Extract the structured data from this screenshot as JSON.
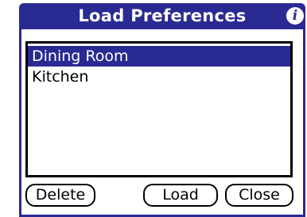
{
  "dialog": {
    "title": "Load Preferences",
    "info_icon": "i",
    "accent_color": "#2a2a93"
  },
  "list": {
    "items": [
      {
        "label": "Dining Room",
        "selected": true
      },
      {
        "label": "Kitchen",
        "selected": false
      }
    ]
  },
  "buttons": {
    "delete_label": "Delete",
    "load_label": "Load",
    "close_label": "Close"
  }
}
